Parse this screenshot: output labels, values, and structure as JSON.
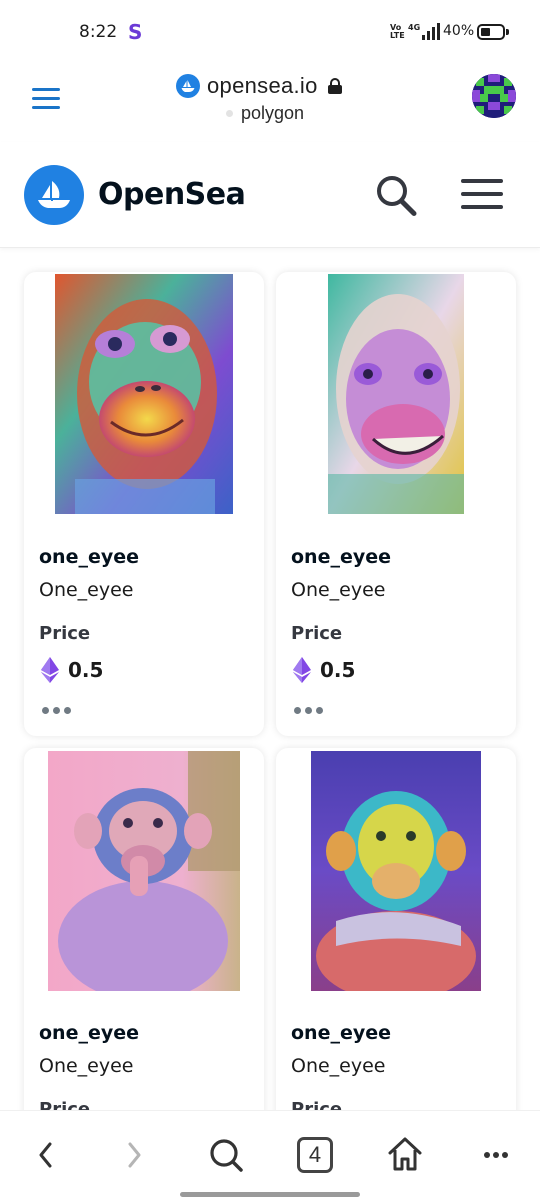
{
  "status_bar": {
    "time": "8:22",
    "app_badge": "S",
    "volte": "Vo LTE",
    "network": "4G",
    "battery": "40%"
  },
  "browser": {
    "url": "opensea.io",
    "network_label": "polygon",
    "tab_count": "4"
  },
  "header": {
    "brand": "OpenSea",
    "brand_color": "#2081e2"
  },
  "cards": [
    {
      "collection": "one_eyee",
      "name": "One_eyee",
      "price_label": "Price",
      "price": "0.5",
      "image": "orangutan-art"
    },
    {
      "collection": "one_eyee",
      "name": "One_eyee",
      "price_label": "Price",
      "price": "0.5",
      "image": "monkey-art"
    },
    {
      "collection": "one_eyee",
      "name": "One_eyee",
      "price_label": "Price",
      "image": "chimp-baby-art"
    },
    {
      "collection": "one_eyee",
      "name": "One_eyee",
      "price_label": "Price",
      "image": "chimp-adult-art"
    }
  ],
  "icons": {
    "back": "chevron-left-icon",
    "forward": "chevron-right-icon",
    "search": "search-icon",
    "home": "home-icon",
    "more": "more-icon"
  }
}
